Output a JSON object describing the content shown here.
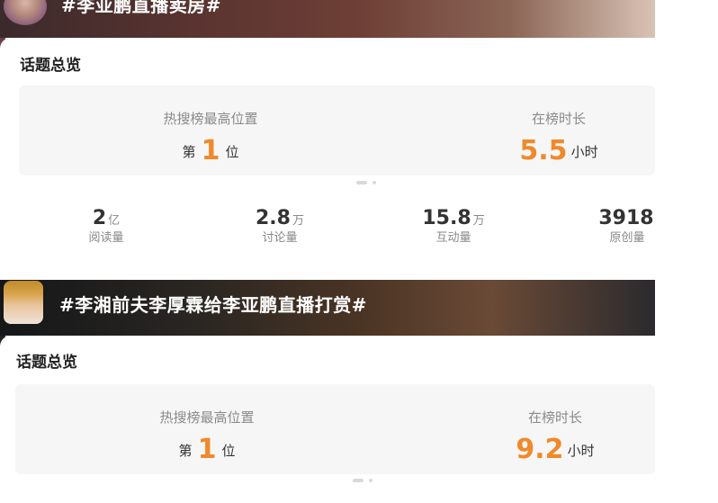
{
  "cards": [
    {
      "banner_title": "#李亚鹏直播卖房#",
      "section_title": "话题总览",
      "stats": [
        {
          "label": "热搜榜最高位置",
          "prefix": "第",
          "value": "1",
          "suffix": "位"
        },
        {
          "label": "在榜时长",
          "prefix": "",
          "value": "5.5",
          "suffix": "小时"
        }
      ],
      "metrics": [
        {
          "value": "2",
          "unit": "亿",
          "label": "阅读量"
        },
        {
          "value": "2.8",
          "unit": "万",
          "label": "讨论量"
        },
        {
          "value": "15.8",
          "unit": "万",
          "label": "互动量"
        },
        {
          "value": "3918",
          "unit": "",
          "label": "原创量"
        }
      ]
    },
    {
      "banner_title": "#李湘前夫李厚霖给李亚鹏直播打赏#",
      "section_title": "话题总览",
      "stats": [
        {
          "label": "热搜榜最高位置",
          "prefix": "第",
          "value": "1",
          "suffix": "位"
        },
        {
          "label": "在榜时长",
          "prefix": "",
          "value": "9.2",
          "suffix": "小时"
        }
      ]
    }
  ],
  "colors": {
    "accent": "#f0892a"
  },
  "icons": {
    "avatar": "avatar-image"
  }
}
